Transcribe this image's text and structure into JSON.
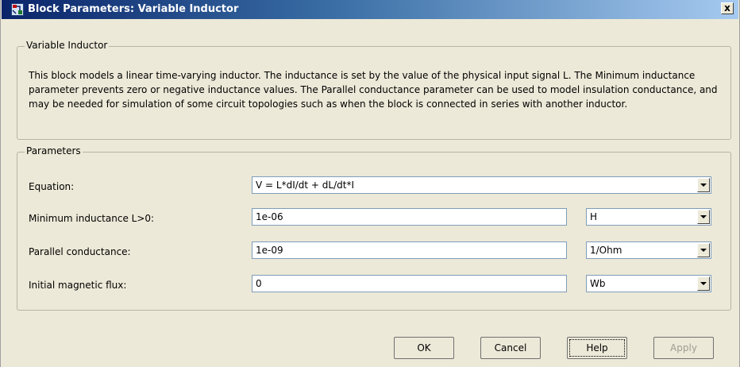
{
  "window": {
    "title": "Block Parameters: Variable Inductor",
    "close_label": "x"
  },
  "description_group": {
    "legend": "Variable Inductor",
    "text": "This block models a linear time-varying inductor. The inductance is set by the value of the physical input signal L. The Minimum inductance parameter prevents zero or negative inductance values. The Parallel conductance parameter can be used to model insulation conductance, and may be needed for simulation of some circuit topologies such as when the block is connected in series with another inductor."
  },
  "parameters_group": {
    "legend": "Parameters",
    "equation": {
      "label": "Equation:",
      "value": "V = L*dI/dt + dL/dt*I"
    },
    "min_inductance": {
      "label": "Minimum inductance L>0:",
      "value": "1e-06",
      "unit": "H"
    },
    "parallel_conductance": {
      "label": "Parallel conductance:",
      "value": "1e-09",
      "unit": "1/Ohm"
    },
    "initial_flux": {
      "label": "Initial magnetic flux:",
      "value": "0",
      "unit": "Wb"
    }
  },
  "buttons": {
    "ok": "OK",
    "cancel": "Cancel",
    "help": "Help",
    "apply": "Apply"
  },
  "icons": {
    "app_icon": "simulink-block-icon",
    "close_icon": "close-icon",
    "dropdown_icon": "chevron-down-icon"
  }
}
